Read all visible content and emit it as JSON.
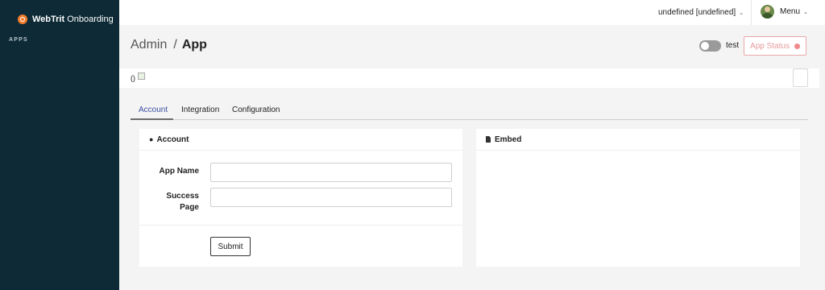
{
  "sidebar": {
    "brand_bold": "WebTrit",
    "brand_rest": " Onboarding",
    "apps_label": "APPS"
  },
  "topbar": {
    "user_select": "undefined [undefined]",
    "menu_label": "Menu"
  },
  "breadcrumb": {
    "parent": "Admin",
    "separator": "/",
    "current": "App"
  },
  "header": {
    "toggle_label": "test",
    "status_button": "App Status"
  },
  "infobar": {
    "text": "()"
  },
  "tabs": [
    {
      "label": "Account"
    },
    {
      "label": "Integration"
    },
    {
      "label": "Configuration"
    }
  ],
  "account_card": {
    "title": "Account",
    "fields": [
      {
        "label": "App Name",
        "value": ""
      },
      {
        "label": "Success Page",
        "value": ""
      }
    ],
    "submit_label": "Submit"
  },
  "embed_card": {
    "title": "Embed"
  },
  "colors": {
    "sidebar_bg": "#0d2a36",
    "brand_accent": "#f07c2b",
    "active_tab": "#3b4fa0",
    "status_red": "#f08a8a"
  }
}
